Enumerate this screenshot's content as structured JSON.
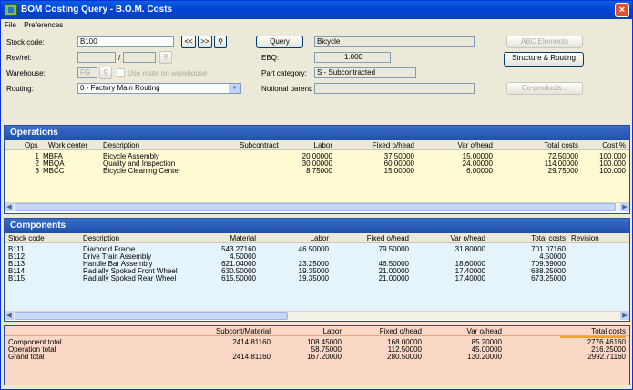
{
  "window": {
    "title": "BOM Costing Query - B.O.M. Costs",
    "close": "×"
  },
  "menu": [
    "File",
    "Preferences"
  ],
  "form": {
    "stock_code_label": "Stock code:",
    "stock_code": "B100",
    "prev": "<<",
    "next": ">>",
    "query_button": "Query",
    "description": "Bicycle",
    "rev_label": "Rev/rel:",
    "rev_sep": "/",
    "ebq_label": "EBQ:",
    "ebq": "1.000",
    "warehouse_label": "Warehouse:",
    "warehouse": "FG",
    "use_route_label": "Use route on warehouse",
    "part_category_label": "Part category:",
    "part_category": "S - Subcontracted",
    "routing_label": "Routing:",
    "routing": "0 - Factory Main Routing",
    "notional_parent_label": "Notional parent:",
    "abc_button": "ABC Elements",
    "structure_button": "Structure & Routing",
    "coproducts_button": "Co-products..."
  },
  "operations": {
    "title": "Operations",
    "headers": [
      "Ops",
      "Work center",
      "Description",
      "Subcontract",
      "Labor",
      "Fixed o/head",
      "Var o/head",
      "Total costs",
      "Cost %"
    ],
    "rows": [
      [
        "1",
        "MBFA",
        "Bicycle Assembly",
        "",
        "20.00000",
        "37.50000",
        "15.00000",
        "72.50000",
        "100.000"
      ],
      [
        "2",
        "MBQA",
        "Quality and Inspection",
        "",
        "30.00000",
        "60.00000",
        "24.00000",
        "114.00000",
        "100.000"
      ],
      [
        "3",
        "MBCC",
        "Bicycle Cleaning Center",
        "",
        "8.75000",
        "15.00000",
        "6.00000",
        "29.75000",
        "100.000"
      ]
    ]
  },
  "components": {
    "title": "Components",
    "headers": [
      "Stock code",
      "Description",
      "Material",
      "Labor",
      "Fixed o/head",
      "Var o/head",
      "Total costs",
      "Revision"
    ],
    "rows": [
      [
        "B111",
        "Diamond Frame",
        "543.27160",
        "46.50000",
        "79.50000",
        "31.80000",
        "701.07160",
        ""
      ],
      [
        "B112",
        "Drive Train Assembly",
        "4.50000",
        "",
        "",
        "",
        "4.50000",
        ""
      ],
      [
        "B113",
        "Handle Bar Assembly",
        "621.04000",
        "23.25000",
        "46.50000",
        "18.60000",
        "709.39000",
        ""
      ],
      [
        "B114",
        "Radially Spoked Front Wheel",
        "630.50000",
        "19.35000",
        "21.00000",
        "17.40000",
        "688.25000",
        ""
      ],
      [
        "B115",
        "Radially Spoked Rear Wheel",
        "615.50000",
        "19.35000",
        "21.00000",
        "17.40000",
        "673.25000",
        ""
      ]
    ]
  },
  "totals": {
    "headers": [
      "",
      "Subcont/Material",
      "Labor",
      "Fixed o/head",
      "Var o/head",
      "Total costs"
    ],
    "rows": [
      [
        "Component total",
        "2414.81160",
        "108.45000",
        "168.00000",
        "85.20000",
        "2776.46160"
      ],
      [
        "Operation total",
        "",
        "58.75000",
        "112.50000",
        "45.00000",
        "216.25000"
      ],
      [
        "Grand total",
        "2414.81160",
        "167.20000",
        "280.50000",
        "130.20000",
        "2992.71160"
      ]
    ]
  },
  "colors": {
    "title_bar": "#0a4fd9",
    "panel_header": "#2a5cbb",
    "ops_bg": "#fffad2",
    "comp_bg": "#e5f3fa",
    "totals_bg": "#fbd7c5"
  }
}
